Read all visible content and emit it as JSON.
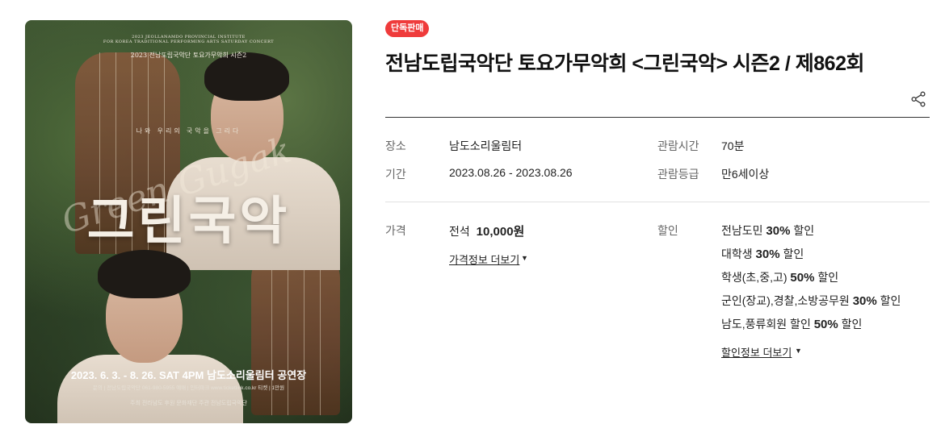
{
  "poster": {
    "top_line1": "2023 JEOLLANAMDO PROVINCIAL INSTITUTE",
    "top_line2": "FOR KOREA TRADITIONAL PERFORMING ARTS SATURDAY CONCERT",
    "top_line3": "2023 전남도립국악단 토요가무악희 시즌2",
    "tagline": "나와 우리의 국악을 그리다",
    "script": "Green Gugak",
    "main_title": "그린국악",
    "date_line": "2023. 6. 3. - 8. 26. SAT 4PM 남도소리울림터 공연장",
    "contact_line": "문의 | 전남도립국악단 061-980-5955  예매 | 인터파크  www.ticketlink.co.kr  티켓 | 1만원",
    "sponsor_line": "주최  전라남도   후원  문화재단   주관  전남도립국악단"
  },
  "badge": "단독판매",
  "title": "전남도립국악단 토요가무악희 <그린국악> 시즌2 / 제862회",
  "info": {
    "venue_label": "장소",
    "venue_value": "남도소리울림터",
    "period_label": "기간",
    "period_value": "2023.08.26 - 2023.08.26",
    "runtime_label": "관람시간",
    "runtime_value": "70분",
    "rating_label": "관람등급",
    "rating_value": "만6세이상"
  },
  "price": {
    "label": "가격",
    "seat": "전석",
    "amount": "10,000원",
    "more": "가격정보 더보기"
  },
  "discount": {
    "label": "할인",
    "items": [
      {
        "name": "전남도민",
        "rate": "30%",
        "suffix": "할인"
      },
      {
        "name": "대학생",
        "rate": "30%",
        "suffix": "할인"
      },
      {
        "name": "학생(초,중,고)",
        "rate": "50%",
        "suffix": "할인"
      },
      {
        "name": "군인(장교),경찰,소방공무원",
        "rate": "30%",
        "suffix": "할인"
      },
      {
        "name": "남도,풍류회원 할인",
        "rate": "50%",
        "suffix": "할인"
      }
    ],
    "more": "할인정보 더보기"
  },
  "icons": {
    "share": "share-icon",
    "caret": "caret-down-icon"
  },
  "colors": {
    "badge": "#ef3b3b",
    "divider": "#333333"
  }
}
